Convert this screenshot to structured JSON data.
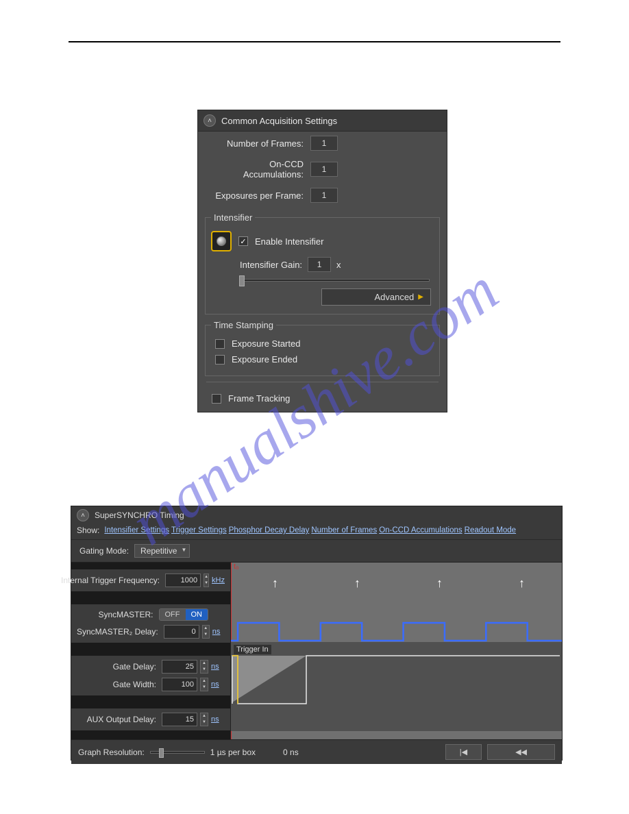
{
  "watermark": "manualshive.com",
  "panel1": {
    "title": "Common Acquisition Settings",
    "fields": {
      "num_frames_label": "Number of Frames:",
      "num_frames_value": "1",
      "onccd_label": "On-CCD Accumulations:",
      "onccd_value": "1",
      "exposures_label": "Exposures per Frame:",
      "exposures_value": "1"
    },
    "intensifier": {
      "legend": "Intensifier",
      "enable_label": "Enable Intensifier",
      "enable_checked": true,
      "gain_label": "Intensifier Gain:",
      "gain_value": "1",
      "gain_unit": "x",
      "advanced_label": "Advanced"
    },
    "time_stamping": {
      "legend": "Time Stamping",
      "exposure_started_label": "Exposure Started",
      "exposure_started_checked": false,
      "exposure_ended_label": "Exposure Ended",
      "exposure_ended_checked": false
    },
    "frame_tracking_label": "Frame Tracking",
    "frame_tracking_checked": false
  },
  "panel2": {
    "title": "SuperSYNCHRO Timing",
    "show_label": "Show:",
    "links": [
      "Intensifier Settings",
      "Trigger Settings",
      "Phosphor Decay Delay",
      "Number of Frames",
      "On-CCD Accumulations",
      "Readout Mode"
    ],
    "gating_mode_label": "Gating Mode:",
    "gating_mode_value": "Repetitive",
    "left": {
      "trig_freq_label": "Internal Trigger Frequency:",
      "trig_freq_value": "1000",
      "trig_freq_unit": "kHz",
      "syncmaster_label": "SyncMASTER:",
      "sync_off": "OFF",
      "sync_on": "ON",
      "sync2_delay_label": "SyncMASTER₂ Delay:",
      "sync2_delay_value": "0",
      "sync2_delay_unit": "ns",
      "gate_delay_label": "Gate Delay:",
      "gate_delay_value": "25",
      "gate_delay_unit": "ns",
      "gate_width_label": "Gate Width:",
      "gate_width_value": "100",
      "gate_width_unit": "ns",
      "aux_delay_label": "AUX Output Delay:",
      "aux_delay_value": "15",
      "aux_delay_unit": "ns"
    },
    "right": {
      "t0_label": "t₀",
      "trigger_in_label": "Trigger In"
    },
    "footer": {
      "graph_res_label": "Graph Resolution:",
      "graph_res_value": "1 µs per box",
      "time_origin": "0 ns",
      "first_btn": "|◀",
      "rew_btn": "◀◀"
    }
  }
}
